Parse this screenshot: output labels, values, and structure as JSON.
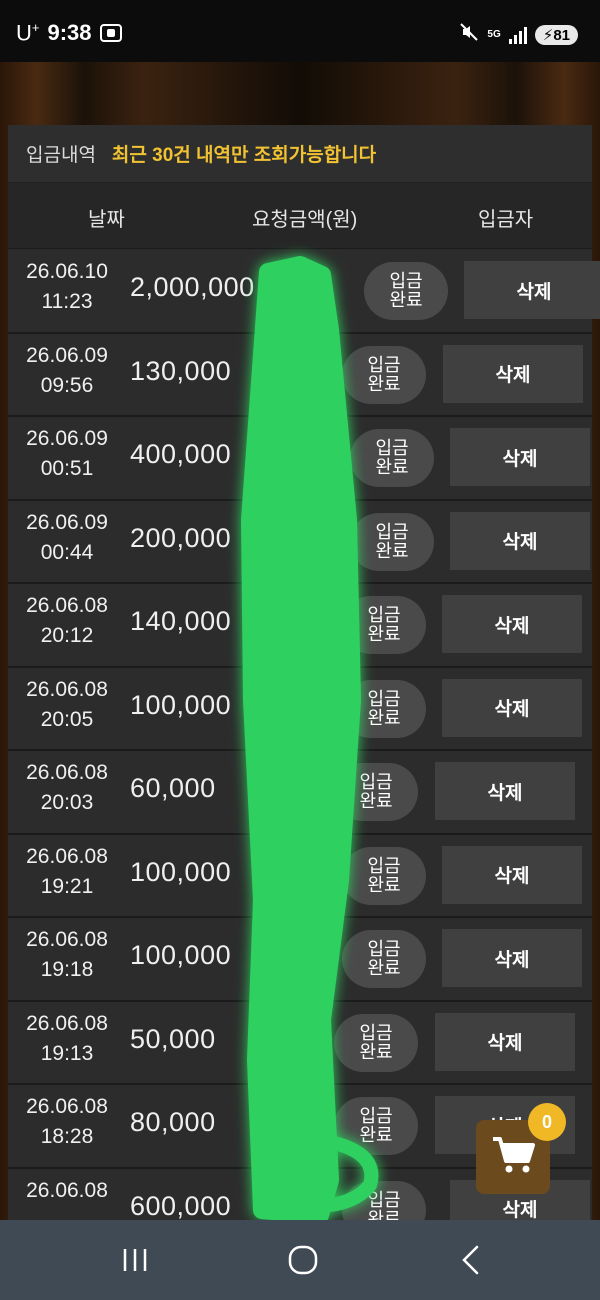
{
  "status_bar": {
    "carrier": "U",
    "carrier_sup": "+",
    "time": "9:38",
    "network": "5G",
    "battery": "81"
  },
  "panel": {
    "title": "입금내역",
    "note": "최근 30건 내역만 조회가능합니다"
  },
  "columns": {
    "date": "날짜",
    "amount": "요청금액(원)",
    "depositor": "입금자"
  },
  "rows": [
    {
      "date": "26.06.10",
      "time": "11:23",
      "amount": "2,000,000",
      "status": "입금\n완료",
      "delete": "삭제"
    },
    {
      "date": "26.06.09",
      "time": "09:56",
      "amount": "130,000",
      "status": "입금\n완료",
      "delete": "삭제"
    },
    {
      "date": "26.06.09",
      "time": "00:51",
      "amount": "400,000",
      "status": "입금\n완료",
      "delete": "삭제"
    },
    {
      "date": "26.06.09",
      "time": "00:44",
      "amount": "200,000",
      "status": "입금\n완료",
      "delete": "삭제"
    },
    {
      "date": "26.06.08",
      "time": "20:12",
      "amount": "140,000",
      "status": "입금\n완료",
      "delete": "삭제"
    },
    {
      "date": "26.06.08",
      "time": "20:05",
      "amount": "100,000",
      "status": "입금\n완료",
      "delete": "삭제"
    },
    {
      "date": "26.06.08",
      "time": "20:03",
      "amount": "60,000",
      "status": "입금\n완료",
      "delete": "삭제"
    },
    {
      "date": "26.06.08",
      "time": "19:21",
      "amount": "100,000",
      "status": "입금\n완료",
      "delete": "삭제"
    },
    {
      "date": "26.06.08",
      "time": "19:18",
      "amount": "100,000",
      "status": "입금\n완료",
      "delete": "삭제"
    },
    {
      "date": "26.06.08",
      "time": "19:13",
      "amount": "50,000",
      "status": "입금\n완료",
      "delete": "삭제"
    },
    {
      "date": "26.06.08",
      "time": "18:28",
      "amount": "80,000",
      "status": "입금\n완료",
      "delete": "삭제"
    },
    {
      "date": "26.06.08",
      "time": "",
      "amount": "600,000",
      "status": "입금\n완료",
      "delete": "삭제"
    }
  ],
  "cart": {
    "count": "0",
    "icon": "cart-icon"
  },
  "nav": {
    "recent": "recents-icon",
    "home": "home-icon",
    "back": "back-icon"
  },
  "colors": {
    "highlight": "#f1c232",
    "scribble": "#2fd15f",
    "cart_badge": "#f1b826"
  }
}
